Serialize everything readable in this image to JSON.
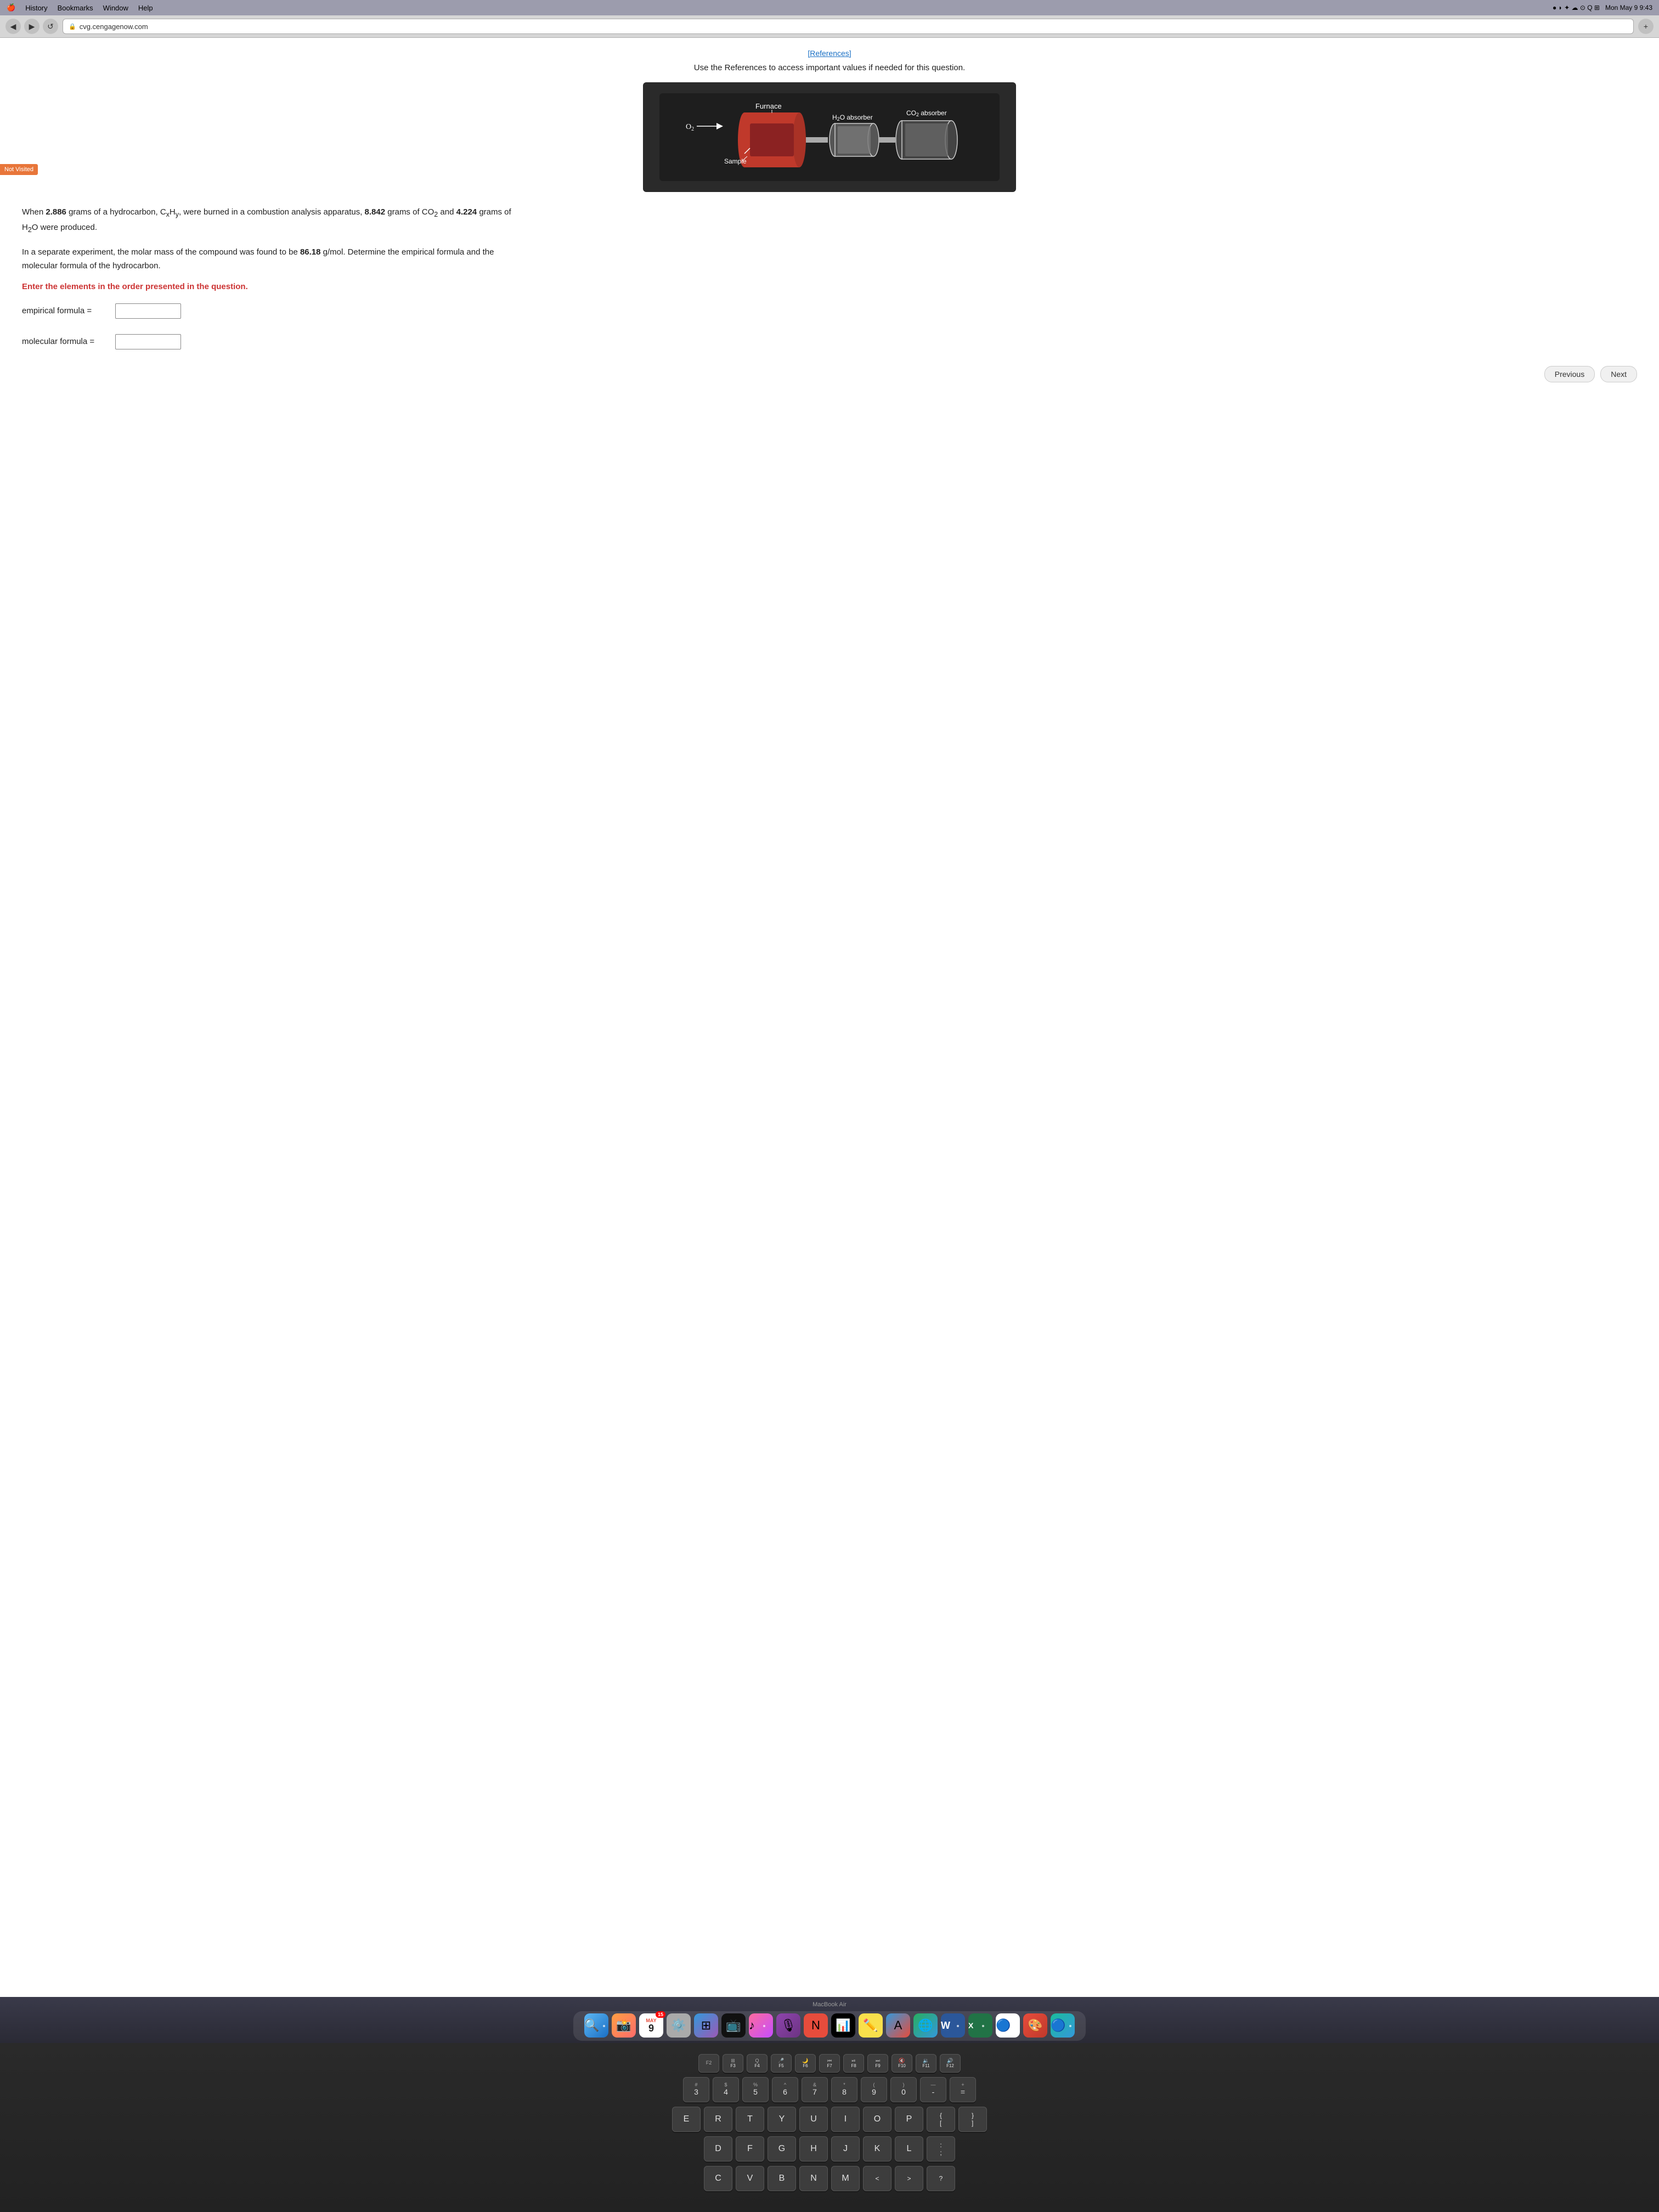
{
  "menubar": {
    "history": "History",
    "bookmarks": "Bookmarks",
    "window": "Window",
    "help": "Help",
    "datetime": "Mon May 9  9:43",
    "apple_icon": "🍎"
  },
  "browser": {
    "url": "cvg.cengagenow.com",
    "lock": "🔒"
  },
  "page": {
    "references_label": "[References]",
    "header": "Use the References to access important values if needed for this question.",
    "not_visited": "Not Visited",
    "apparatus_labels": {
      "o2": "O₂",
      "furnace": "Furnace",
      "h2o": "H₂O absorber",
      "co2": "CO₂ absorber",
      "sample": "Sample"
    },
    "question_part1": "When ",
    "question_bold1": "2.886",
    "question_part2": " grams of a hydrocarbon, C",
    "question_sub1": "x",
    "question_part3": "H",
    "question_sub2": "y",
    "question_part4": ", were burned in a combustion analysis apparatus, ",
    "question_bold2": "8.842",
    "question_part5": " grams of CO₂ and ",
    "question_bold3": "4.224",
    "question_part6": " grams of H₂O were produced.",
    "question2": "In a separate experiment, the molar mass of the compound was found to be ",
    "question2_bold": "86.18",
    "question2_rest": " g/mol. Determine the empirical formula and the molecular formula of the hydrocarbon.",
    "instruction": "Enter the elements in the order presented in the question.",
    "empirical_label": "empirical formula =",
    "molecular_label": "molecular formula =",
    "empirical_value": "",
    "molecular_value": "",
    "previous_btn": "Previous",
    "next_btn": "Next"
  },
  "dock": {
    "macbook_air": "MacBook Air",
    "items": [
      {
        "icon": "🔍",
        "label": "finder",
        "active": true
      },
      {
        "icon": "📸",
        "label": "photos",
        "active": false
      },
      {
        "icon": "📅",
        "label": "calendar",
        "badge": "15",
        "active": false
      },
      {
        "icon": "⚙️",
        "label": "settings",
        "active": false
      },
      {
        "icon": "📋",
        "label": "launchpad",
        "active": false
      },
      {
        "icon": "📺",
        "label": "appletv",
        "active": false
      },
      {
        "icon": "🎵",
        "label": "music",
        "active": true
      },
      {
        "icon": "🎙",
        "label": "podcasts",
        "active": false
      },
      {
        "icon": "📰",
        "label": "news",
        "active": false
      },
      {
        "icon": "📊",
        "label": "stocks",
        "active": false
      },
      {
        "icon": "🎯",
        "label": "reminder",
        "active": false
      },
      {
        "icon": "✏️",
        "label": "notes",
        "active": false
      },
      {
        "icon": "🅰",
        "label": "font",
        "active": false
      },
      {
        "icon": "🌐",
        "label": "chrome",
        "active": false
      },
      {
        "icon": "📝",
        "label": "word",
        "active": true
      },
      {
        "icon": "📈",
        "label": "excel",
        "active": true
      },
      {
        "icon": "🔴",
        "label": "chrome2",
        "active": true
      },
      {
        "icon": "🎨",
        "label": "art",
        "active": false
      },
      {
        "icon": "🔵",
        "label": "safari",
        "active": true
      }
    ]
  },
  "keyboard": {
    "rows": [
      [
        "F2",
        "F3",
        "F4",
        "F5",
        "F6",
        "F7",
        "F8",
        "F9",
        "F10",
        "F11",
        "F12"
      ],
      [
        "3",
        "4",
        "5",
        "6",
        "7",
        "8",
        "9",
        "0"
      ],
      [
        "E",
        "R",
        "T",
        "Y",
        "U",
        "I",
        "O",
        "P"
      ],
      [
        "D",
        "F",
        "G",
        "H",
        "J",
        "K",
        "L"
      ],
      [
        "C",
        "V",
        "B",
        "N",
        "M",
        "<",
        ">",
        "?"
      ]
    ]
  }
}
